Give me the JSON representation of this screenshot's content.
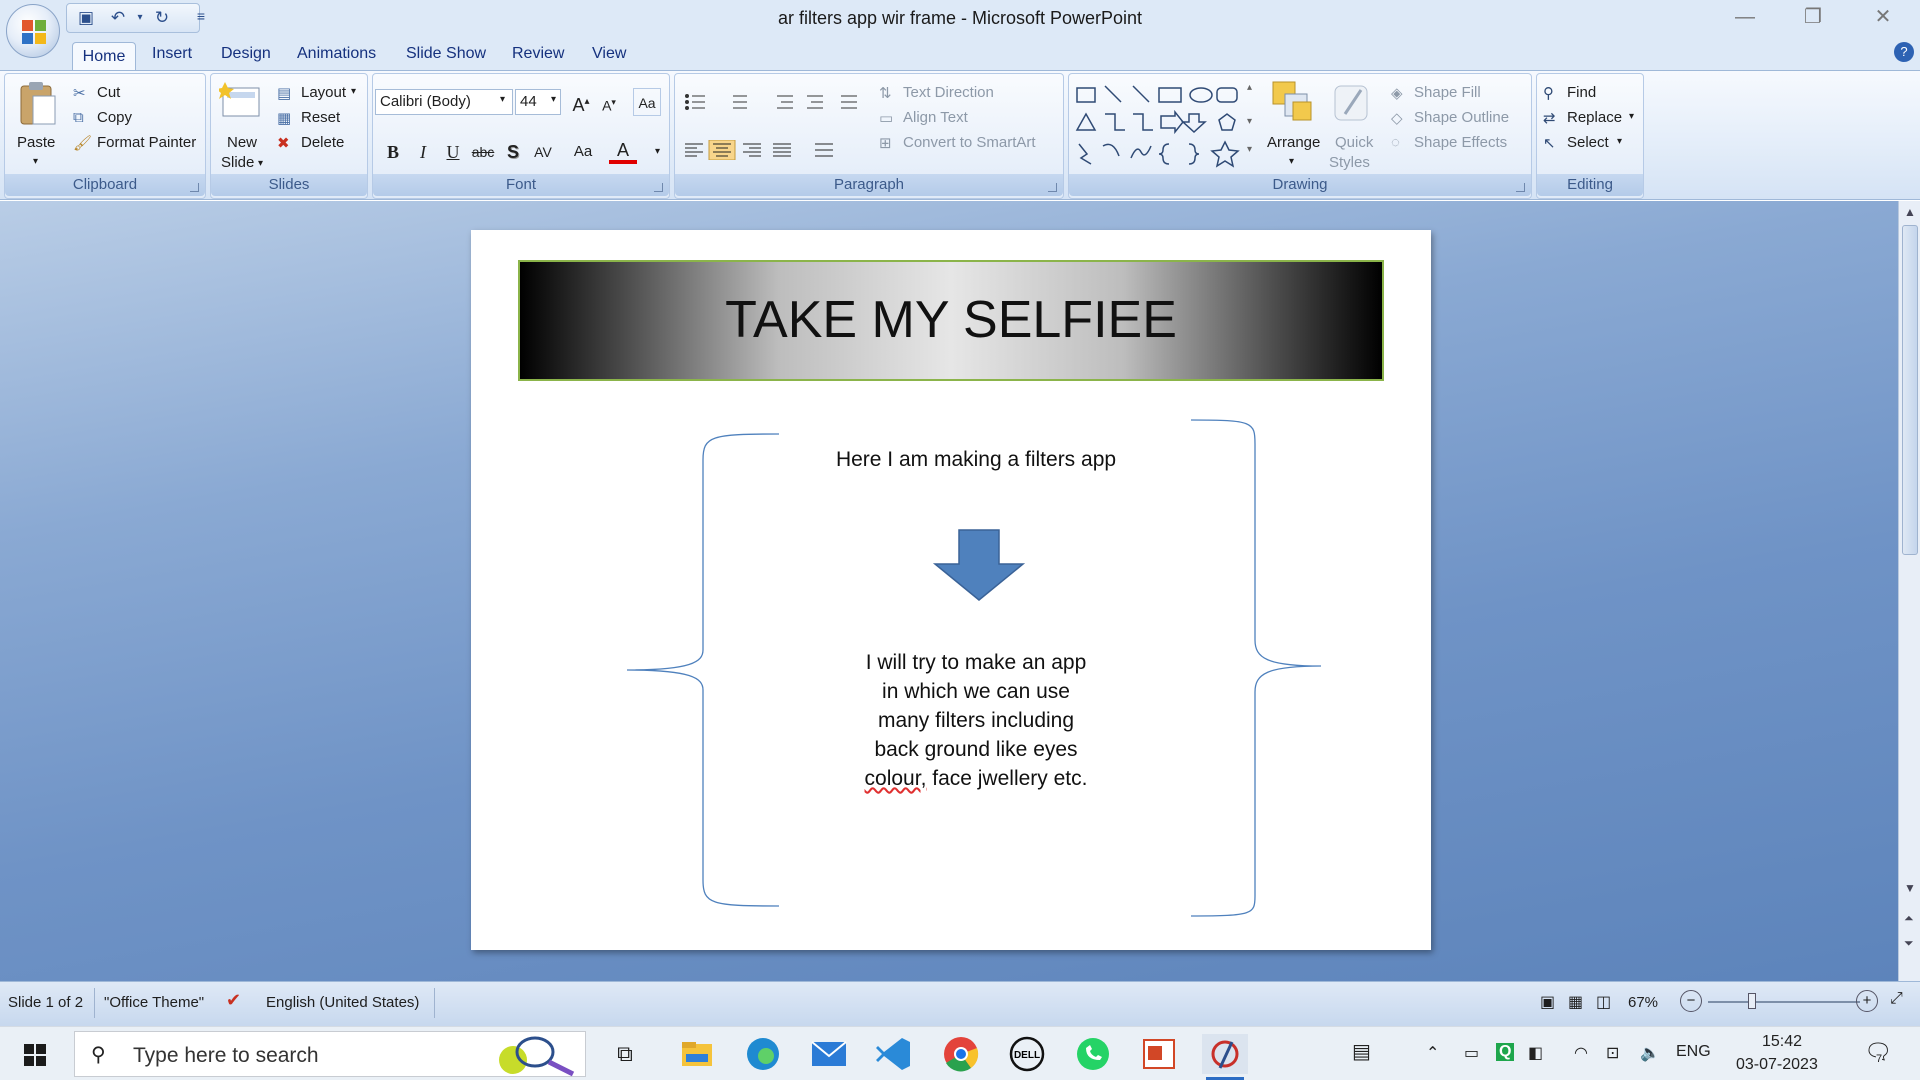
{
  "window": {
    "title": "ar filters app wir frame - Microsoft PowerPoint"
  },
  "tabs": [
    "Home",
    "Insert",
    "Design",
    "Animations",
    "Slide Show",
    "Review",
    "View"
  ],
  "ribbon": {
    "clipboard": {
      "paste": "Paste",
      "cut": "Cut",
      "copy": "Copy",
      "format_painter": "Format Painter",
      "label": "Clipboard"
    },
    "slides": {
      "new_slide_1": "New",
      "new_slide_2": "Slide",
      "layout": "Layout",
      "reset": "Reset",
      "delete": "Delete",
      "label": "Slides"
    },
    "font": {
      "name": "Calibri (Body)",
      "size": "44",
      "bold": "B",
      "italic": "I",
      "underline": "U",
      "strike": "abc",
      "shadow": "S",
      "spacing": "AV",
      "case": "Aa",
      "color": "A",
      "label": "Font"
    },
    "paragraph": {
      "text_direction": "Text Direction",
      "align_text": "Align Text",
      "convert_smartart": "Convert to SmartArt",
      "label": "Paragraph"
    },
    "drawing": {
      "arrange": "Arrange",
      "quick_styles_1": "Quick",
      "quick_styles_2": "Styles",
      "shape_fill": "Shape Fill",
      "shape_outline": "Shape Outline",
      "shape_effects": "Shape Effects",
      "label": "Drawing"
    },
    "editing": {
      "find": "Find",
      "replace": "Replace",
      "select": "Select",
      "label": "Editing"
    }
  },
  "slide": {
    "title": "TAKE MY SELFIEE",
    "intro": "Here I am making  a filters app",
    "body_lines": [
      "I will try to make an app",
      "in which we can use",
      "many filters including",
      "back ground like eyes"
    ],
    "body_last_misspelled": "colour,",
    "body_last_rest": " face jwellery  etc."
  },
  "status": {
    "slide": "Slide 1 of 2",
    "theme": "\"Office Theme\"",
    "language": "English (United States)",
    "zoom": "67%"
  },
  "taskbar": {
    "search_placeholder": "Type here to search",
    "lang": "ENG",
    "time": "15:42",
    "date": "03-07-2023",
    "notif_count": "7"
  },
  "colors": {
    "ribbon_bg": "#dde9f7",
    "slide_bg": "#6f93c6",
    "title_border": "#8bb44a",
    "arrow": "#4f81bd",
    "brace": "#4f81bd"
  }
}
